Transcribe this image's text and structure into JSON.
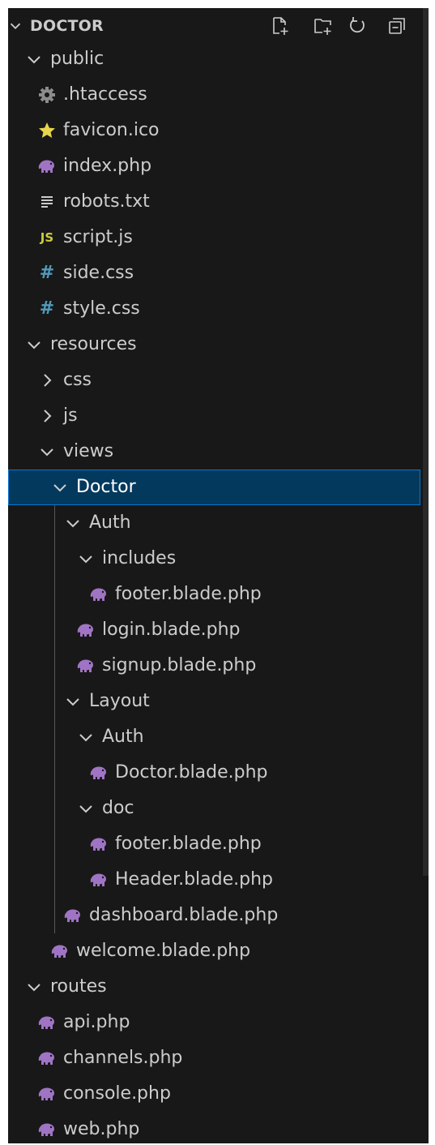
{
  "explorer": {
    "title": "DOCTOR",
    "actions": [
      {
        "name": "new-file-icon"
      },
      {
        "name": "new-folder-icon"
      },
      {
        "name": "refresh-icon"
      },
      {
        "name": "collapse-all-icon"
      }
    ]
  },
  "tree": [
    {
      "label": "public",
      "kind": "folder",
      "depth": 0
    },
    {
      "label": ".htaccess",
      "kind": "gear",
      "depth": 1
    },
    {
      "label": "favicon.ico",
      "kind": "star",
      "depth": 1
    },
    {
      "label": "index.php",
      "kind": "php",
      "depth": 1
    },
    {
      "label": "robots.txt",
      "kind": "text",
      "depth": 1
    },
    {
      "label": "script.js",
      "kind": "js",
      "depth": 1,
      "badge": "JS"
    },
    {
      "label": "side.css",
      "kind": "css",
      "depth": 1,
      "badge": "#"
    },
    {
      "label": "style.css",
      "kind": "css",
      "depth": 1,
      "badge": "#"
    },
    {
      "label": "resources",
      "kind": "folder",
      "depth": 0
    },
    {
      "label": "css",
      "kind": "folder-closed",
      "depth": 1
    },
    {
      "label": "js",
      "kind": "folder-closed",
      "depth": 1
    },
    {
      "label": "views",
      "kind": "folder",
      "depth": 1
    },
    {
      "label": "Doctor",
      "kind": "folder",
      "depth": 2,
      "selected": true
    },
    {
      "label": "Auth",
      "kind": "folder",
      "depth": 3
    },
    {
      "label": "includes",
      "kind": "folder",
      "depth": 4
    },
    {
      "label": "footer.blade.php",
      "kind": "php",
      "depth": 5
    },
    {
      "label": "login.blade.php",
      "kind": "php",
      "depth": 4
    },
    {
      "label": "signup.blade.php",
      "kind": "php",
      "depth": 4
    },
    {
      "label": "Layout",
      "kind": "folder",
      "depth": 3
    },
    {
      "label": "Auth",
      "kind": "folder",
      "depth": 4
    },
    {
      "label": "Doctor.blade.php",
      "kind": "php",
      "depth": 5
    },
    {
      "label": "doc",
      "kind": "folder",
      "depth": 4
    },
    {
      "label": "footer.blade.php",
      "kind": "php",
      "depth": 5
    },
    {
      "label": "Header.blade.php",
      "kind": "php",
      "depth": 5
    },
    {
      "label": "dashboard.blade.php",
      "kind": "php",
      "depth": 3
    },
    {
      "label": "welcome.blade.php",
      "kind": "php",
      "depth": 2
    },
    {
      "label": "routes",
      "kind": "folder",
      "depth": 0
    },
    {
      "label": "api.php",
      "kind": "php",
      "depth": 1
    },
    {
      "label": "channels.php",
      "kind": "php",
      "depth": 1
    },
    {
      "label": "console.php",
      "kind": "php",
      "depth": 1
    },
    {
      "label": "web.php",
      "kind": "php",
      "depth": 1
    }
  ],
  "colors": {
    "background": "#181818",
    "text": "#cccccc",
    "selection": "#04395e",
    "selection_border": "#0078d4",
    "php_icon": "#a074c4",
    "star_icon": "#e8d44d",
    "js_icon": "#cbcb41",
    "css_icon": "#519aba",
    "gear_icon": "#8c8c8c"
  }
}
